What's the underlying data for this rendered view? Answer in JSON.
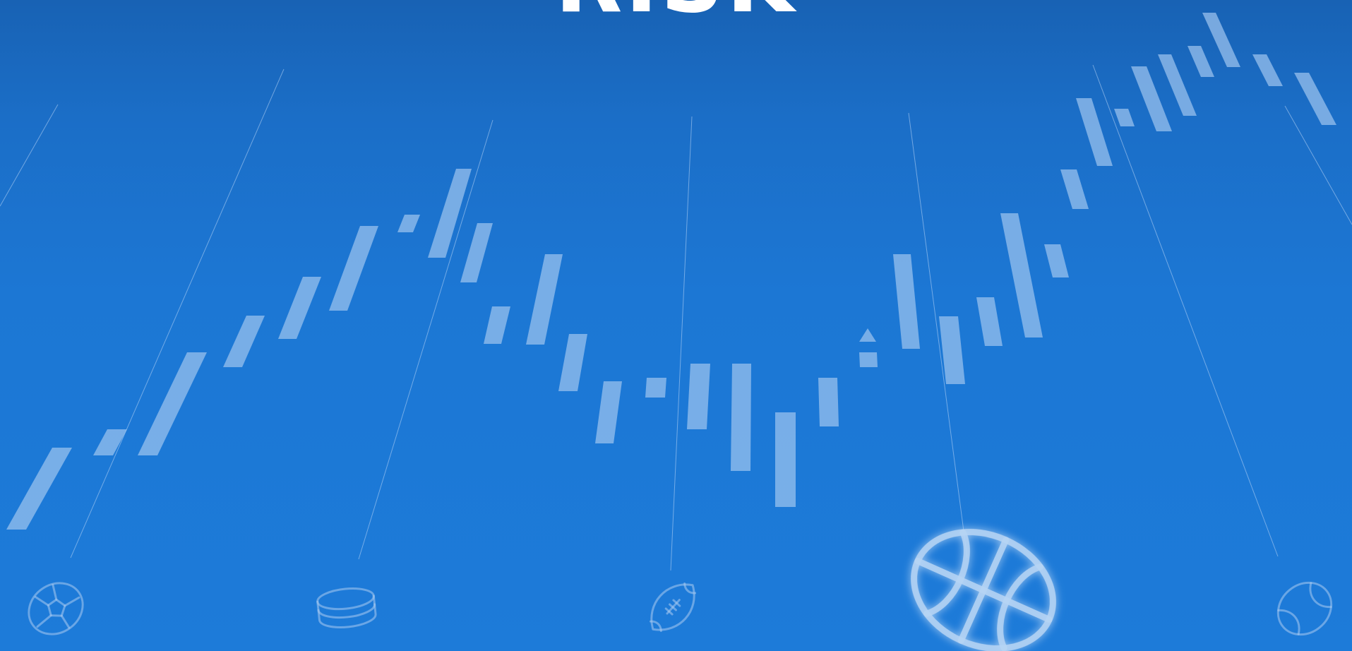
{
  "hero": {
    "title": "RISK"
  },
  "background": {
    "gradient_top": "#1862b4",
    "gradient_bottom": "#1d7bd9",
    "bar_color": "#9cc3ee"
  },
  "sport_icons": [
    {
      "name": "soccer-ball-icon",
      "highlighted": false
    },
    {
      "name": "hockey-puck-icon",
      "highlighted": false
    },
    {
      "name": "american-football-icon",
      "highlighted": false
    },
    {
      "name": "basketball-icon",
      "highlighted": true
    },
    {
      "name": "tennis-ball-icon",
      "highlighted": false
    }
  ]
}
